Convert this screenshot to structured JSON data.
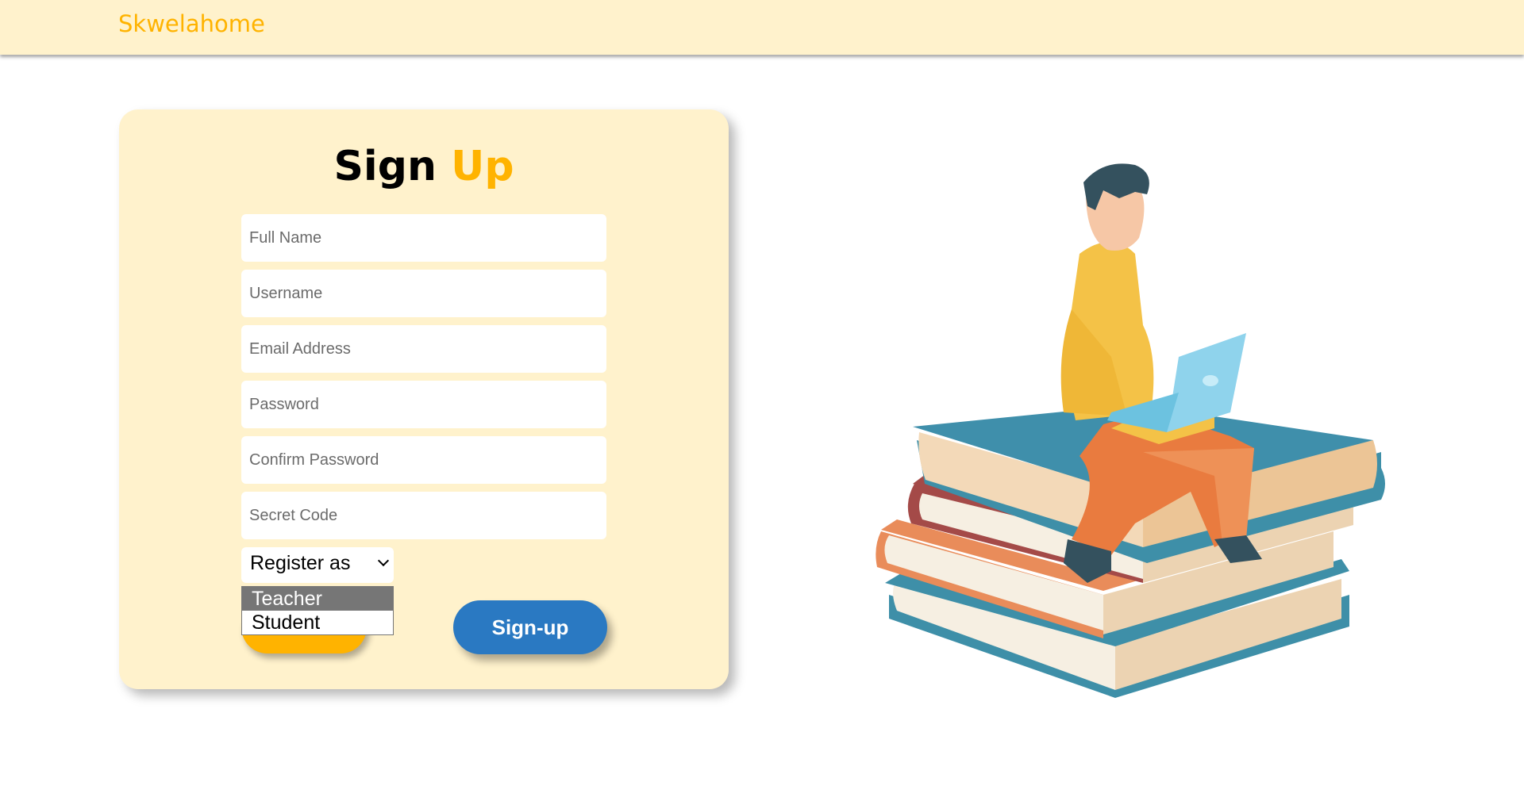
{
  "navbar": {
    "brand": "Skwelahome"
  },
  "form": {
    "title_part1": "Sign",
    "title_part2": "Up",
    "fields": {
      "full_name": "Full Name",
      "username": "Username",
      "email": "Email Address",
      "password": "Password",
      "confirm_password": "Confirm Password",
      "secret_code": "Secret Code"
    },
    "register_select": {
      "label": "Register as",
      "options": [
        "Teacher",
        "Student"
      ],
      "highlighted": "Teacher"
    },
    "signup_label": "Sign-up"
  },
  "colors": {
    "accent": "#ffb300",
    "navbar_bg": "#fff2cc",
    "button_blue": "#2a79c2"
  }
}
